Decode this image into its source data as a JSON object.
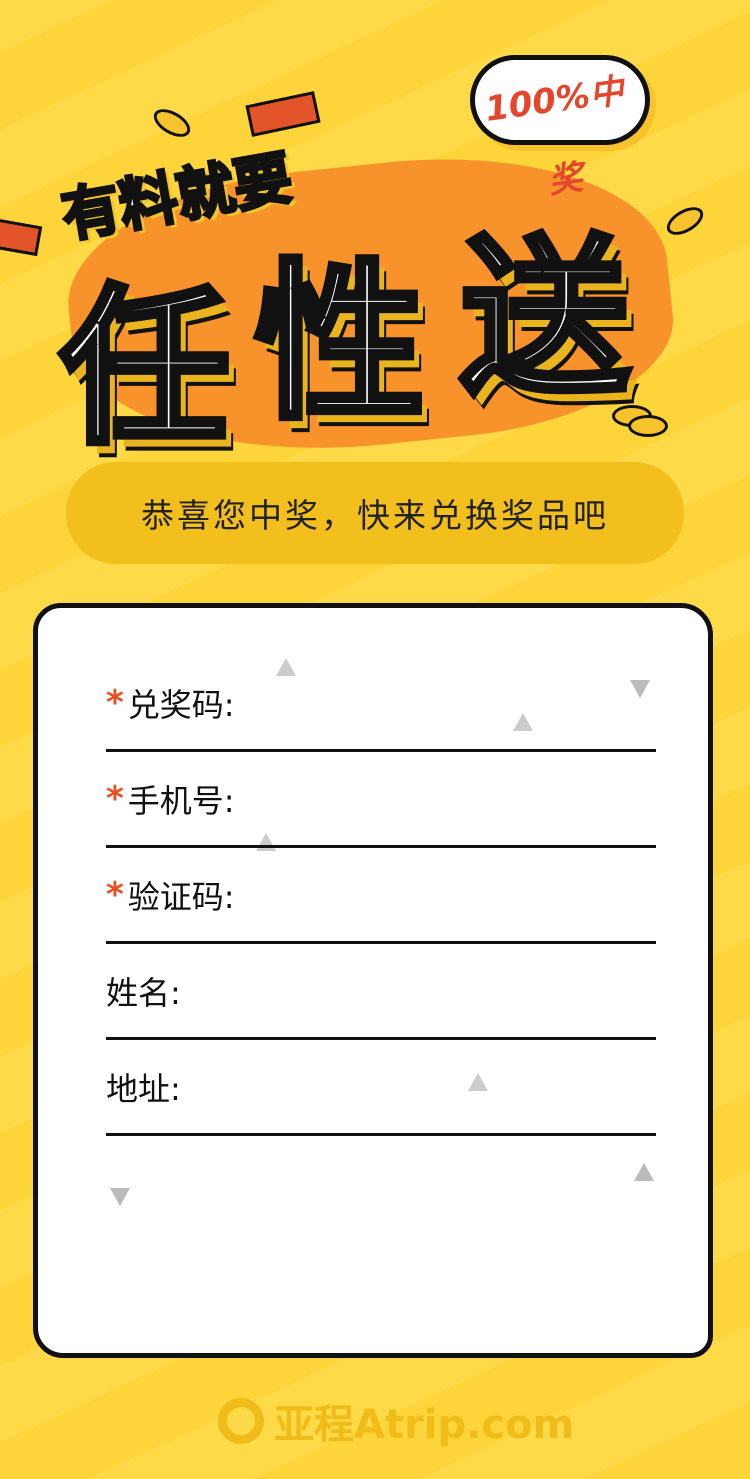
{
  "hero": {
    "subtitle": "有料就要",
    "title_chars": [
      "任",
      "性",
      "送"
    ],
    "badge": "100%中奖"
  },
  "banner": "恭喜您中奖，快来兑换奖品吧",
  "form": {
    "fields": [
      {
        "label": "兑奖码:",
        "required": true,
        "value": ""
      },
      {
        "label": "手机号:",
        "required": true,
        "value": ""
      },
      {
        "label": "验证码:",
        "required": true,
        "value": ""
      },
      {
        "label": "姓名:",
        "required": false,
        "value": ""
      },
      {
        "label": "地址:",
        "required": false,
        "value": ""
      }
    ],
    "required_mark": "*"
  },
  "footer": {
    "logo_text": "亚程Atrip.com",
    "logo_icon": "chat-bubble-bird-icon"
  },
  "colors": {
    "background": "#fdd53a",
    "accent_orange": "#f8922a",
    "required": "#ee4a22",
    "banner": "#f2bf1c"
  }
}
